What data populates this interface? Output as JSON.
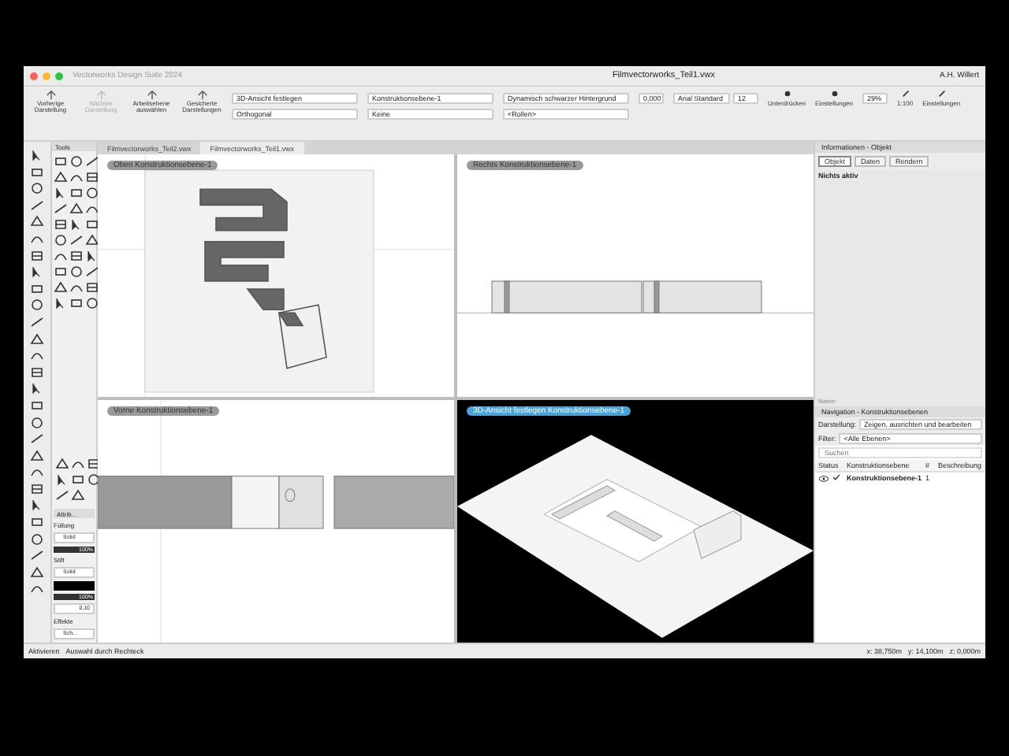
{
  "window": {
    "app_name": "Vectorworks Design Suite 2024",
    "title": "Filmvectorworks_Teil1.vwx",
    "user": "A.H. Willert"
  },
  "toolbar": {
    "buttons": [
      {
        "label": "Vorherige Darstellung",
        "disabled": false
      },
      {
        "label": "Nächste Darstellung",
        "disabled": true
      },
      {
        "label": "Arbeitsebene auswählen",
        "disabled": false
      },
      {
        "label": "Gesicherte Darstellungen",
        "disabled": false
      }
    ],
    "fields": [
      {
        "value": "3D-Ansicht festlegen"
      },
      {
        "value": "Orthogonal"
      },
      {
        "value": "Konstruktionsebene-1"
      },
      {
        "value": "Keine"
      },
      {
        "value": "Dynamisch schwarzer Hintergrund"
      },
      {
        "value": "<Rollen>"
      }
    ],
    "dimension_field": "0,000",
    "font_field": "Arial Standard",
    "size_field": "12",
    "zoom_field": "29%",
    "right_buttons": [
      {
        "label": "Unterdrücken"
      },
      {
        "label": "Einstellungen"
      },
      {
        "label": "1:100"
      },
      {
        "label": "Einstellungen"
      }
    ]
  },
  "document_tabs": [
    {
      "label": "Filmvectorworks_Teil2.vwx",
      "selected": false
    },
    {
      "label": "Filmvectorworks_Teil1.vwx",
      "selected": true
    }
  ],
  "tools_palette": {
    "title": "Tools"
  },
  "attributes": {
    "title": "Attrib...",
    "fill_label": "Füllung",
    "fill_style": "Solid",
    "fill_opacity": "100%",
    "pen_label": "Stift",
    "pen_style": "Solid",
    "pen_opacity": "100%",
    "line_weight": "0,10",
    "effects_label": "Effekte",
    "shadow": "Sch..."
  },
  "viewports": [
    {
      "kind": "top",
      "label": "Oben  Konstruktionsebene-1",
      "selected": false
    },
    {
      "kind": "right",
      "label": "Rechts  Konstruktionsebene-1",
      "selected": false
    },
    {
      "kind": "front",
      "label": "Vorne  Konstruktionsebene-1",
      "selected": false
    },
    {
      "kind": "iso",
      "label": "3D-Ansicht festlegen  Konstruktionsebene-1",
      "selected": true
    }
  ],
  "info_palette": {
    "title": "Informationen - Objekt",
    "tabs": [
      {
        "label": "Objekt",
        "selected": true
      },
      {
        "label": "Daten",
        "selected": false
      },
      {
        "label": "Rendern",
        "selected": false
      }
    ],
    "message": "Nichts aktiv",
    "name_label": "Name:"
  },
  "navigation": {
    "title": "Navigation - Konstruktionsebenen",
    "display_label": "Darstellung:",
    "display_value": "Zeigen, ausrichten und bearbeiten",
    "filter_label": "Filter:",
    "filter_value": "<Alle Ebenen>",
    "search_placeholder": "Suchen",
    "columns": [
      "Status",
      "Konstruktionsebene",
      "#",
      "Beschreibung"
    ],
    "rows": [
      {
        "active": true,
        "name": "Konstruktionsebene-1",
        "number": "1"
      }
    ]
  },
  "status_bar": {
    "tool": "Aktivieren",
    "mode": "Auswahl durch Rechteck",
    "x": "x: 38,750m",
    "y": "y: 14,100m",
    "z": "z: 0,000m"
  }
}
